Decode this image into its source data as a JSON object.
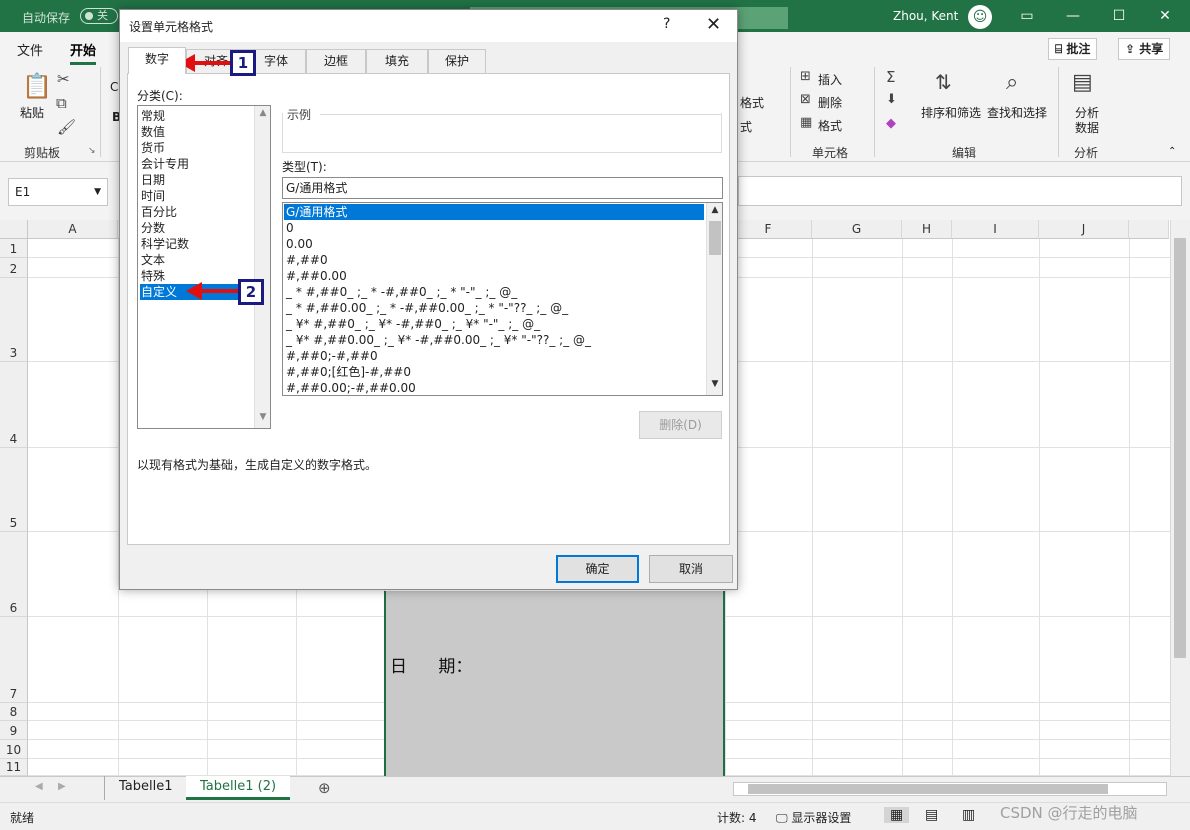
{
  "titlebar": {
    "autosave_label": "自动保存",
    "autosave_state": "关",
    "user_name": "Zhou, Kent",
    "brand_color": "#217346"
  },
  "ribbon": {
    "tabs": [
      "文件",
      "开始"
    ],
    "active_tab": "开始",
    "clipboard": {
      "paste": "粘贴",
      "group": "剪贴板",
      "font_partial": "C",
      "bold_partial": "B"
    },
    "styles": {
      "format_table": "格式",
      "cell_styles": "式"
    },
    "cells": {
      "insert": "插入",
      "delete": "删除",
      "format": "格式",
      "group": "单元格"
    },
    "editing": {
      "sort_filter": "排序和筛选",
      "find_select": "查找和选择",
      "group": "编辑"
    },
    "analysis": {
      "analyze_data_l1": "分析",
      "analyze_data_l2": "数据",
      "group": "分析"
    },
    "comments_btn": "批注",
    "share_btn": "共享"
  },
  "formula_bar": {
    "name_box": "E1"
  },
  "grid": {
    "columns": [
      "A",
      "F",
      "G",
      "H",
      "I",
      "J"
    ],
    "rows": [
      "1",
      "2",
      "3",
      "4",
      "5",
      "6",
      "7",
      "8",
      "9",
      "10",
      "11"
    ],
    "cell_text": "日 期："
  },
  "sheets": {
    "tabs": [
      "Tabelle1",
      "Tabelle1 (2)"
    ],
    "active": "Tabelle1 (2)"
  },
  "status": {
    "ready": "就绪",
    "count": "计数: 4",
    "display_settings": "显示器设置"
  },
  "dialog": {
    "title": "设置单元格格式",
    "help": "?",
    "tabs": [
      "数字",
      "对齐",
      "字体",
      "边框",
      "填充",
      "保护"
    ],
    "active_tab": "数字",
    "category_label": "分类(C):",
    "categories": [
      "常规",
      "数值",
      "货币",
      "会计专用",
      "日期",
      "时间",
      "百分比",
      "分数",
      "科学记数",
      "文本",
      "特殊",
      "自定义"
    ],
    "selected_category": "自定义",
    "sample_label": "示例",
    "type_label": "类型(T):",
    "type_value": "G/通用格式",
    "formats": [
      "G/通用格式",
      "0",
      "0.00",
      "#,##0",
      "#,##0.00",
      "_ * #,##0_ ;_ * -#,##0_ ;_ * \"-\"_ ;_ @_",
      "_ * #,##0.00_ ;_ * -#,##0.00_ ;_ * \"-\"??_ ;_ @_",
      "_ ¥* #,##0_ ;_ ¥* -#,##0_ ;_ ¥* \"-\"_ ;_ @_",
      "_ ¥* #,##0.00_ ;_ ¥* -#,##0.00_ ;_ ¥* \"-\"??_ ;_ @_",
      "#,##0;-#,##0",
      "#,##0;[红色]-#,##0",
      "#,##0.00;-#,##0.00"
    ],
    "delete_btn": "删除(D)",
    "description": "以现有格式为基础，生成自定义的数字格式。",
    "ok_btn": "确定",
    "cancel_btn": "取消"
  },
  "annotations": {
    "callout_1": "1",
    "callout_2": "2"
  },
  "watermark": "CSDN @行走的电脑"
}
